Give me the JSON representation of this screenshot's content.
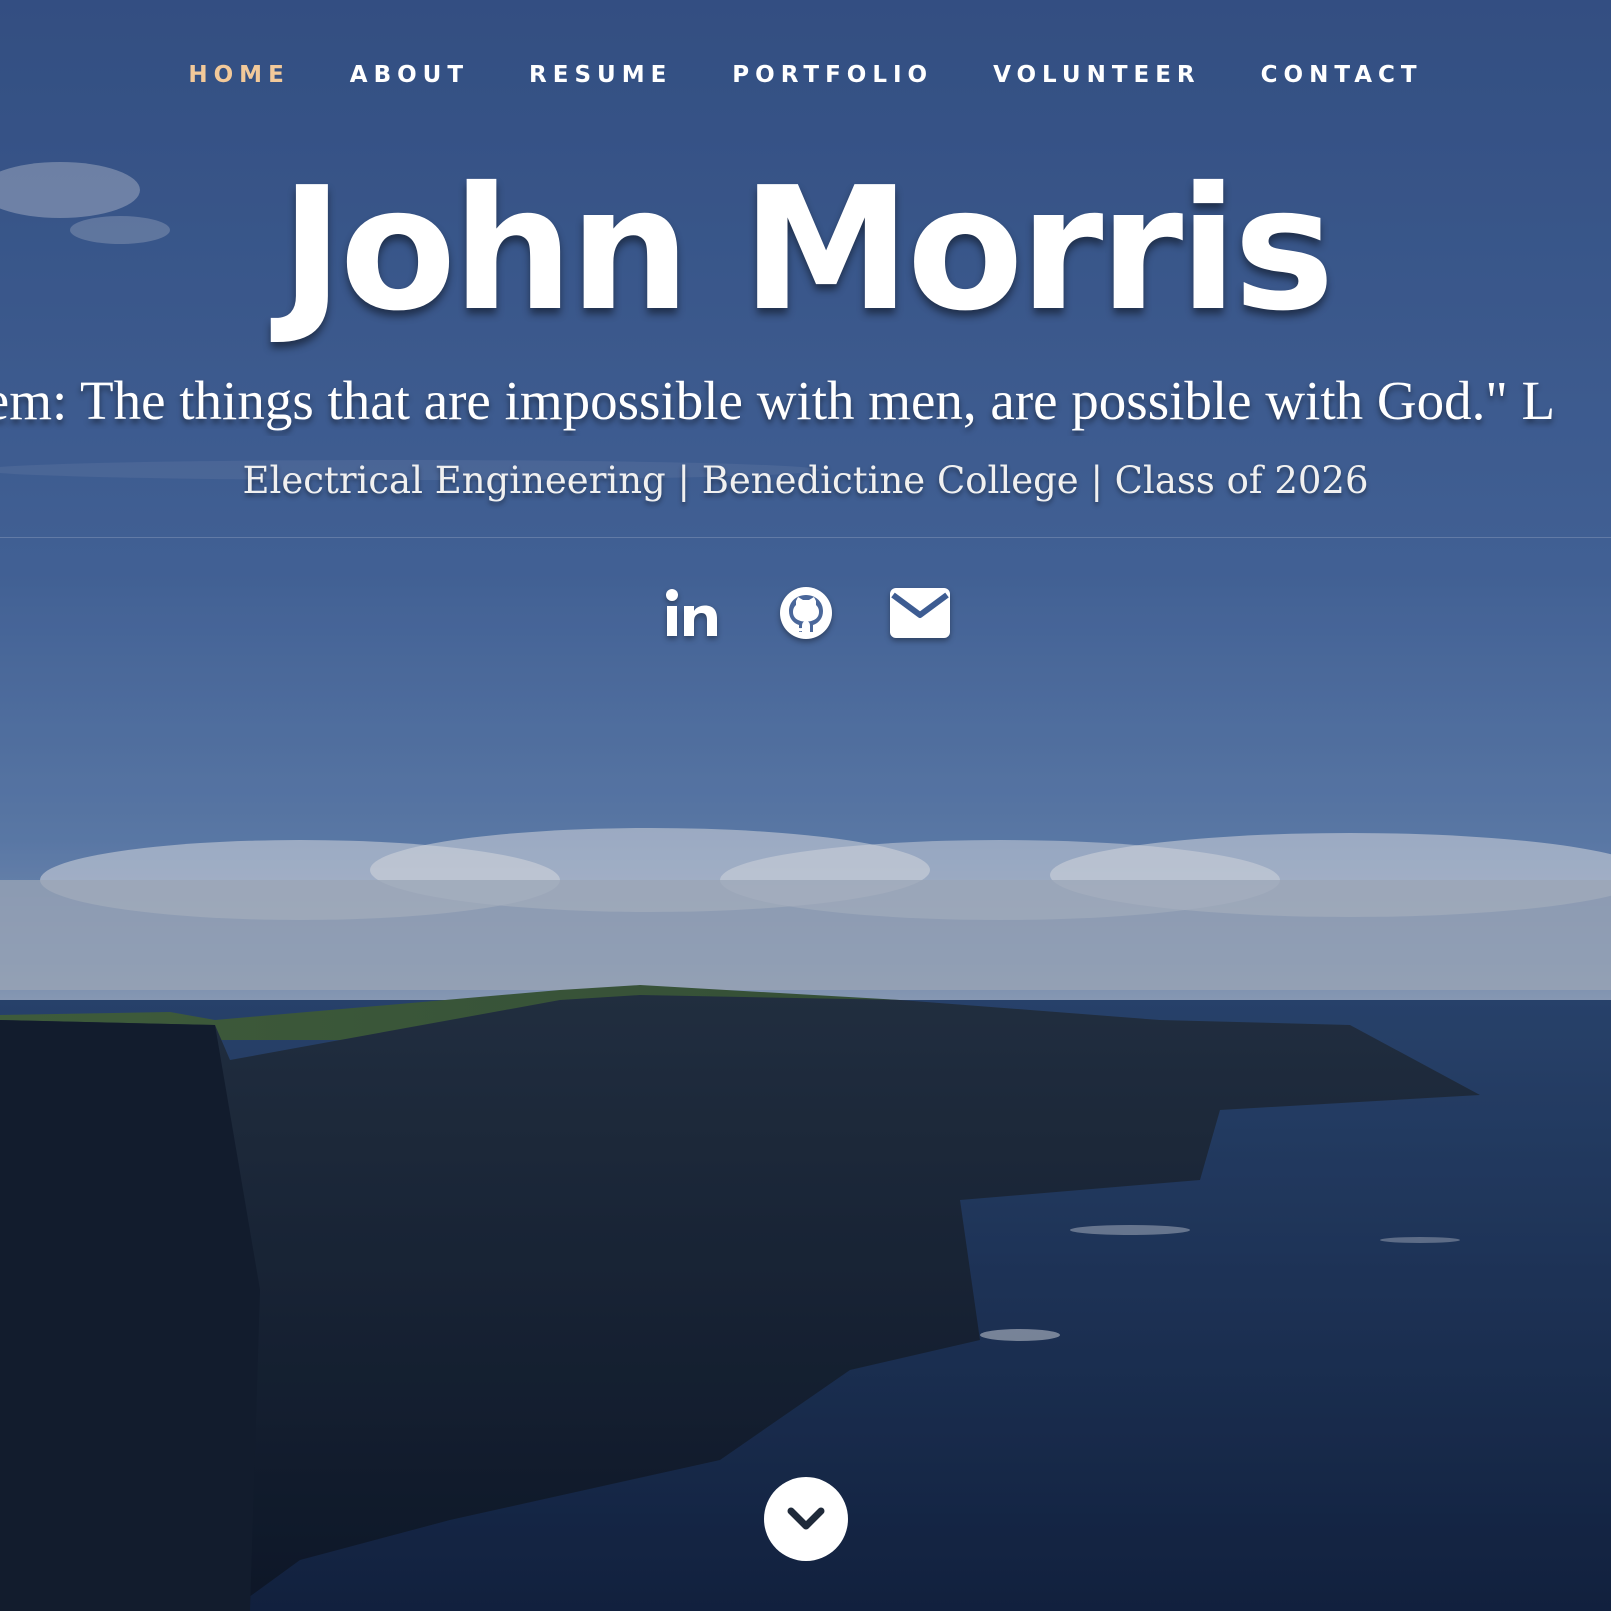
{
  "nav": {
    "items": [
      {
        "label": "HOME",
        "active": true
      },
      {
        "label": "ABOUT",
        "active": false
      },
      {
        "label": "RESUME",
        "active": false
      },
      {
        "label": "PORTFOLIO",
        "active": false
      },
      {
        "label": "VOLUNTEER",
        "active": false
      },
      {
        "label": "CONTACT",
        "active": false
      }
    ],
    "active_color": "#f2c99a"
  },
  "hero": {
    "name": "John Morris",
    "quote": "them: The things that are impossible with men, are possible with God.\" L",
    "subtitle": "Electrical Engineering | Benedictine College | Class of 2026"
  },
  "social": [
    {
      "icon": "linkedin-icon"
    },
    {
      "icon": "github-icon"
    },
    {
      "icon": "envelope-icon"
    }
  ],
  "scroll": {
    "icon": "chevron-down-icon"
  }
}
